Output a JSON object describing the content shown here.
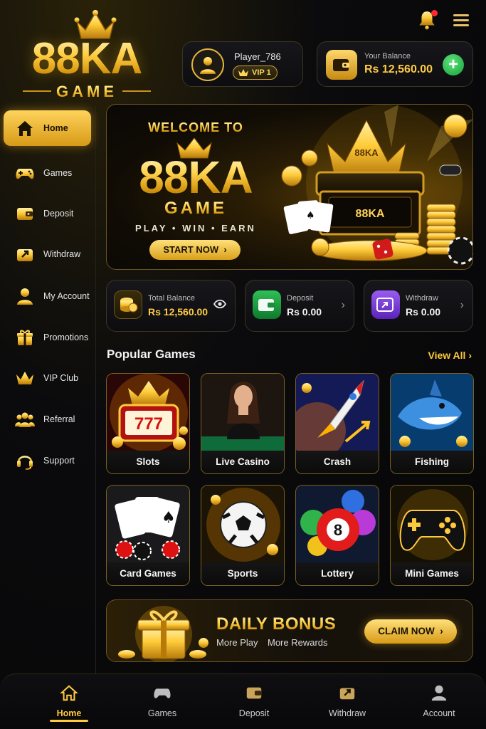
{
  "app": {
    "logo_main": "88KA",
    "logo_sub": "GAME"
  },
  "header": {
    "notification_icon": "bell-icon",
    "menu_icon": "hamburger-icon",
    "player_name": "Player_786",
    "vip_level": "VIP 1",
    "balance_label": "Your Balance",
    "balance_value": "Rs 12,560.00",
    "add_icon": "plus-icon"
  },
  "sidebar": {
    "items": [
      {
        "label": "Home",
        "icon": "home-icon",
        "active": true
      },
      {
        "label": "Games",
        "icon": "gamepad-icon"
      },
      {
        "label": "Deposit",
        "icon": "wallet-icon"
      },
      {
        "label": "Withdraw",
        "icon": "withdraw-icon"
      },
      {
        "label": "My Account",
        "icon": "user-icon"
      },
      {
        "label": "Promotions",
        "icon": "gift-icon"
      },
      {
        "label": "VIP Club",
        "icon": "crown-icon"
      },
      {
        "label": "Referral",
        "icon": "group-icon"
      },
      {
        "label": "Support",
        "icon": "headset-icon"
      }
    ]
  },
  "banner": {
    "welcome": "WELCOME TO",
    "brand": "88KA",
    "game": "GAME",
    "tagline": "PLAY  •  WIN  •  EARN",
    "cta": "START NOW",
    "screen_text": "88KA",
    "chest_text": "88KA",
    "crown_text": "88KA"
  },
  "stats": [
    {
      "label": "Total Balance",
      "value": "Rs 12,560.00",
      "icon": "coins-icon",
      "action_icon": "eye-icon"
    },
    {
      "label": "Deposit",
      "value": "Rs 0.00",
      "icon": "wallet-icon",
      "action_icon": "chevron-right-icon"
    },
    {
      "label": "Withdraw",
      "value": "Rs 0.00",
      "icon": "withdraw-icon",
      "action_icon": "chevron-right-icon"
    }
  ],
  "popular": {
    "title": "Popular Games",
    "view_all": "View All",
    "games": [
      {
        "label": "Slots",
        "art_text": "777"
      },
      {
        "label": "Live Casino"
      },
      {
        "label": "Crash"
      },
      {
        "label": "Fishing"
      },
      {
        "label": "Card Games"
      },
      {
        "label": "Sports"
      },
      {
        "label": "Lottery",
        "art_text": "8"
      },
      {
        "label": "Mini Games"
      }
    ]
  },
  "bonus": {
    "title": "DAILY BONUS",
    "sub1": "More Play",
    "sub2": "More Rewards",
    "cta": "CLAIM NOW"
  },
  "bottom_nav": [
    {
      "label": "Home",
      "icon": "home-icon",
      "active": true
    },
    {
      "label": "Games",
      "icon": "gamepad-icon"
    },
    {
      "label": "Deposit",
      "icon": "wallet-icon"
    },
    {
      "label": "Withdraw",
      "icon": "withdraw-icon"
    },
    {
      "label": "Account",
      "icon": "user-icon"
    }
  ],
  "colors": {
    "gold": "#ffc93d",
    "dark_bg": "#0b0b0d",
    "green": "#15a33a",
    "purple": "#7b3fd1"
  }
}
